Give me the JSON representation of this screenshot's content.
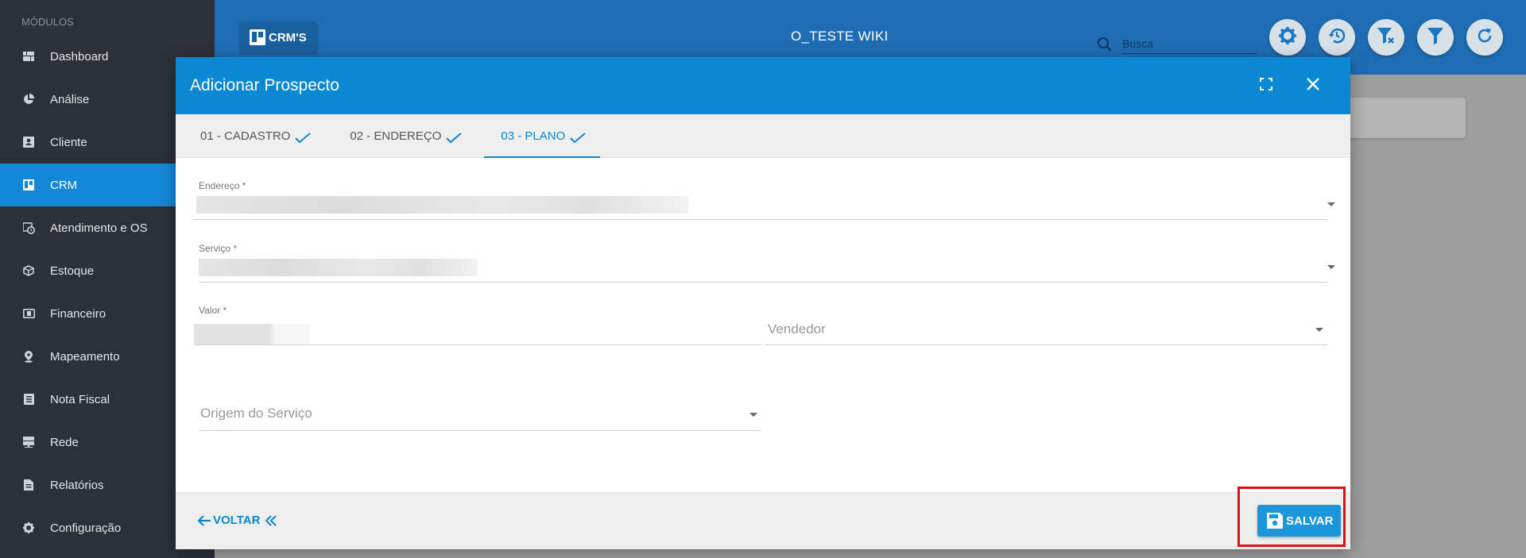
{
  "sidebar": {
    "heading": "MÓDULOS",
    "items": [
      {
        "label": "Dashboard",
        "icon": "dashboard-icon"
      },
      {
        "label": "Análise",
        "icon": "pie-chart-icon"
      },
      {
        "label": "Cliente",
        "icon": "contact-card-icon"
      },
      {
        "label": "CRM",
        "icon": "trello-board-icon",
        "active": true
      },
      {
        "label": "Atendimento e OS",
        "icon": "calendar-clock-icon"
      },
      {
        "label": "Estoque",
        "icon": "box-icon"
      },
      {
        "label": "Financeiro",
        "icon": "money-icon"
      },
      {
        "label": "Mapeamento",
        "icon": "map-pin-icon"
      },
      {
        "label": "Nota Fiscal",
        "icon": "list-doc-icon"
      },
      {
        "label": "Rede",
        "icon": "server-icon"
      },
      {
        "label": "Relatórios",
        "icon": "report-icon"
      },
      {
        "label": "Configuração",
        "icon": "gear-icon"
      }
    ]
  },
  "topbar": {
    "crms_label": "CRM'S",
    "app_title": "O_TESTE WIKI",
    "search_placeholder": "Busca",
    "actions": [
      "settings-icon",
      "history-icon",
      "filter-clear-icon",
      "filter-icon",
      "refresh-icon"
    ]
  },
  "modal": {
    "title": "Adicionar Prospecto",
    "tabs": [
      {
        "label": "01 - CADASTRO",
        "done": true
      },
      {
        "label": "02 - ENDEREÇO",
        "done": true
      },
      {
        "label": "03 - PLANO",
        "done": true,
        "active": true
      }
    ],
    "fields": {
      "endereco_label": "Endereço *",
      "servico_label": "Serviço *",
      "valor_label": "Valor *",
      "vendedor_placeholder": "Vendedor",
      "origem_placeholder": "Origem do Serviço"
    },
    "footer": {
      "back_label": "VOLTAR",
      "save_label": "SALVAR"
    }
  },
  "colors": {
    "primary": "#0a88d2",
    "sidebar_bg": "#2c3038",
    "topbar_bg": "#1e6db4",
    "highlight": "#e01010"
  }
}
